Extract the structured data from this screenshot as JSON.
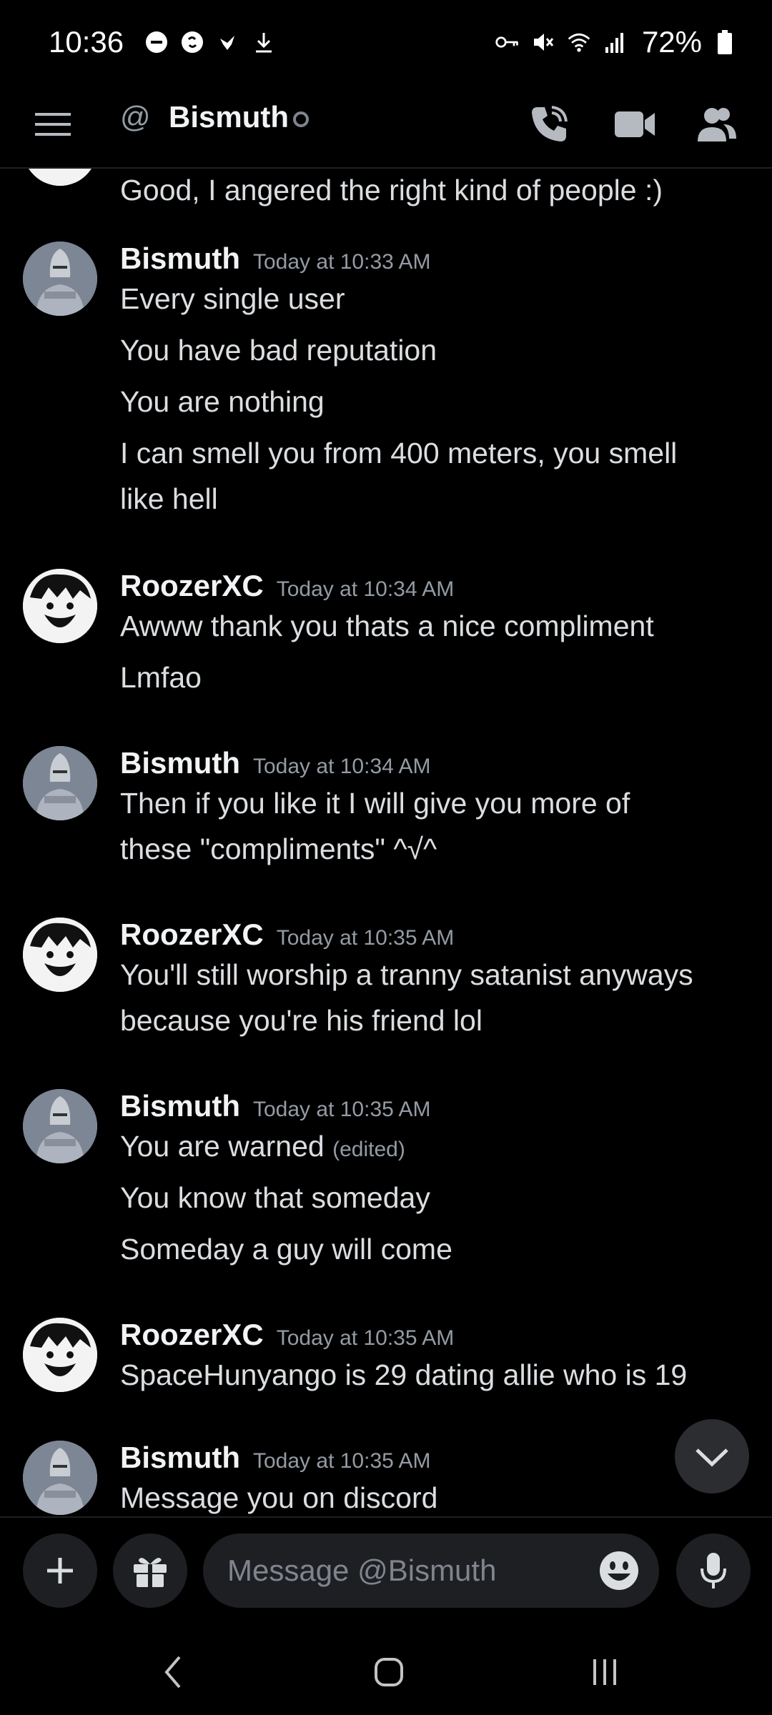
{
  "status_bar": {
    "time": "10:36",
    "battery": "72%",
    "left_icons": [
      "do-not-disturb-icon",
      "shazam-icon",
      "bird-icon",
      "download-icon"
    ],
    "right_icons": [
      "vpn-key-icon",
      "mute-icon",
      "wifi-icon",
      "signal-icon",
      "battery-icon"
    ]
  },
  "header": {
    "title": "Bismuth",
    "at_symbol": "@",
    "status": "offline"
  },
  "messages": [
    {
      "author": "",
      "timestamp": "",
      "lines": [
        "Good, I angered the right kind of people :)"
      ],
      "avatar": "anime"
    },
    {
      "author": "Bismuth",
      "timestamp": "Today at 10:33 AM",
      "avatar": "knight",
      "lines": [
        "Every single user",
        "You have bad reputation",
        "You are nothing",
        "I can smell you from 400 meters, you smell",
        "like hell"
      ]
    },
    {
      "author": "RoozerXC",
      "timestamp": "Today at 10:34 AM",
      "avatar": "anime",
      "lines": [
        "Awww thank you thats a nice compliment",
        "Lmfao"
      ]
    },
    {
      "author": "Bismuth",
      "timestamp": "Today at 10:34 AM",
      "avatar": "knight",
      "lines": [
        "Then if you like it I will give you more of",
        "these \"compliments\" ^√^"
      ]
    },
    {
      "author": "RoozerXC",
      "timestamp": "Today at 10:35 AM",
      "avatar": "anime",
      "lines": [
        "You'll still worship a tranny satanist anyways",
        "because you're his friend lol"
      ]
    },
    {
      "author": "Bismuth",
      "timestamp": "Today at 10:35 AM",
      "avatar": "knight",
      "lines": [
        "You are warned",
        "You know that someday",
        "Someday a guy will come"
      ],
      "edited": "(edited)"
    },
    {
      "author": "RoozerXC",
      "timestamp": "Today at 10:35 AM",
      "avatar": "anime",
      "lines": [
        "SpaceHunyango is 29 dating allie who is 19"
      ]
    },
    {
      "author": "Bismuth",
      "timestamp": "Today at 10:35 AM",
      "avatar": "knight",
      "lines": [
        "Message you on discord"
      ]
    }
  ],
  "composer": {
    "placeholder": "Message @Bismuth"
  },
  "colors": {
    "background": "#000000",
    "text": "#dbdee1",
    "muted": "#949ba4",
    "input_bg": "#1e1f22"
  }
}
